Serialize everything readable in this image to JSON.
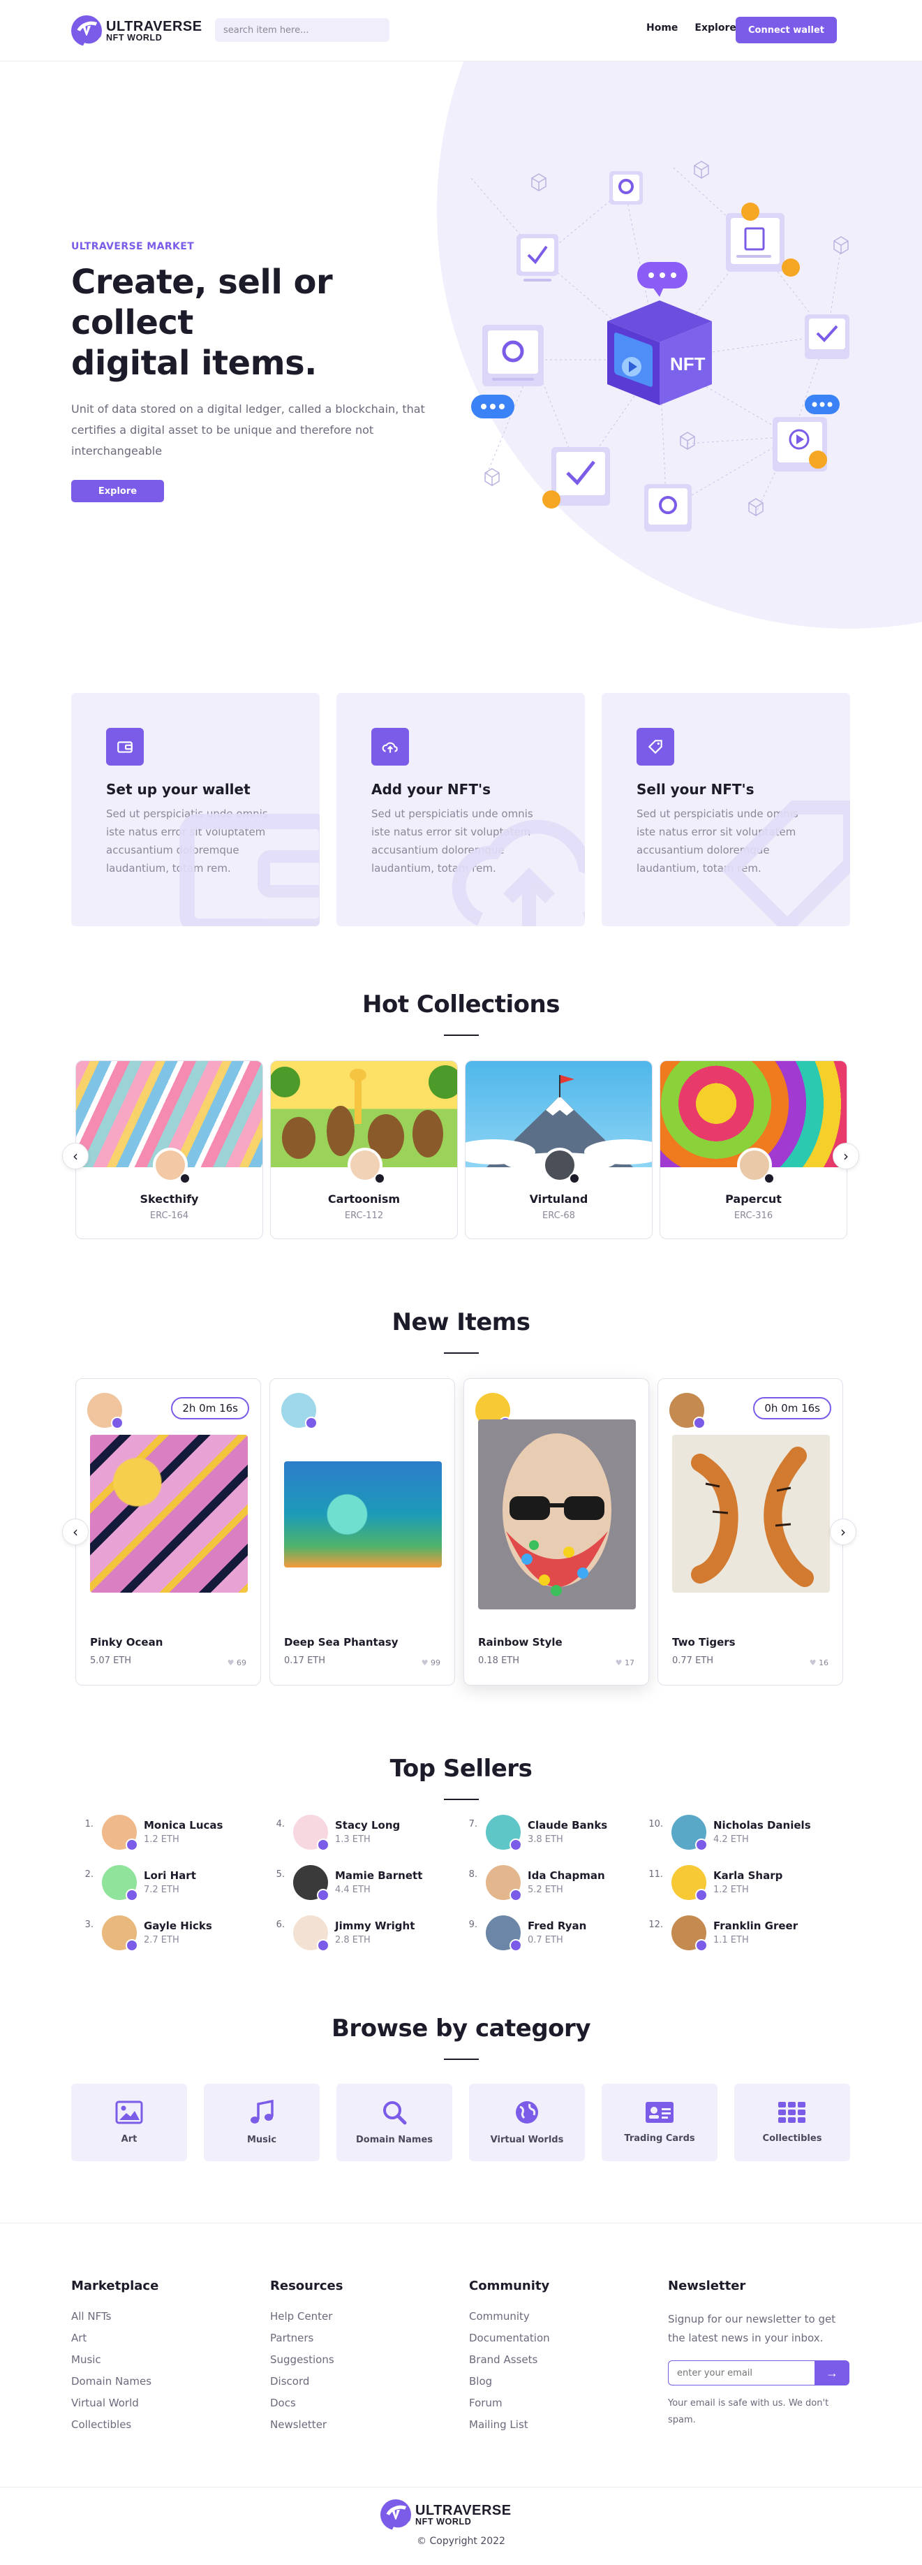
{
  "brand": {
    "name": "ULTRAVERSE",
    "tagline": "NFT WORLD"
  },
  "header": {
    "search_placeholder": "search item here...",
    "nav": [
      "Home",
      "Explore"
    ],
    "connect_label": "Connect wallet"
  },
  "hero": {
    "eyebrow": "ULTRAVERSE MARKET",
    "title_line1": "Create, sell or collect",
    "title_line2": "digital items.",
    "description": "Unit of data stored on a digital ledger, called a blockchain, that certifies a digital asset to be unique and therefore not interchangeable",
    "cta_label": "Explore",
    "illustration_label": "NFT"
  },
  "features": [
    {
      "icon": "wallet-icon",
      "title": "Set up your wallet",
      "desc": "Sed ut perspiciatis unde omnis iste natus error sit voluptatem accusantium doloremque laudantium, totam rem."
    },
    {
      "icon": "cloud-upload-icon",
      "title": "Add your NFT's",
      "desc": "Sed ut perspiciatis unde omnis iste natus error sit voluptatem accusantium doloremque laudantium, totam rem."
    },
    {
      "icon": "tag-icon",
      "title": "Sell your NFT's",
      "desc": "Sed ut perspiciatis unde omnis iste natus error sit voluptatem accusantium doloremque laudantium, totam rem."
    }
  ],
  "hot_collections": {
    "title": "Hot Collections",
    "items": [
      {
        "name": "Skecthify",
        "code": "ERC-164"
      },
      {
        "name": "Cartoonism",
        "code": "ERC-112"
      },
      {
        "name": "Virtuland",
        "code": "ERC-68"
      },
      {
        "name": "Papercut",
        "code": "ERC-316"
      }
    ]
  },
  "new_items": {
    "title": "New Items",
    "items": [
      {
        "name": "Pinky Ocean",
        "price": "5.07 ETH",
        "likes": "69",
        "timer": "2h 0m 16s"
      },
      {
        "name": "Deep Sea Phantasy",
        "price": "0.17 ETH",
        "likes": "99",
        "timer": ""
      },
      {
        "name": "Rainbow Style",
        "price": "0.18 ETH",
        "likes": "17",
        "timer": ""
      },
      {
        "name": "Two Tigers",
        "price": "0.77 ETH",
        "likes": "16",
        "timer": "0h 0m 16s"
      }
    ]
  },
  "top_sellers": {
    "title": "Top Sellers",
    "items": [
      {
        "rank": "1.",
        "name": "Monica Lucas",
        "eth": "1.2 ETH"
      },
      {
        "rank": "2.",
        "name": "Lori Hart",
        "eth": "7.2 ETH"
      },
      {
        "rank": "3.",
        "name": "Gayle Hicks",
        "eth": "2.7 ETH"
      },
      {
        "rank": "4.",
        "name": "Stacy Long",
        "eth": "1.3 ETH"
      },
      {
        "rank": "5.",
        "name": "Mamie Barnett",
        "eth": "4.4 ETH"
      },
      {
        "rank": "6.",
        "name": "Jimmy Wright",
        "eth": "2.8 ETH"
      },
      {
        "rank": "7.",
        "name": "Claude Banks",
        "eth": "3.8 ETH"
      },
      {
        "rank": "8.",
        "name": "Ida Chapman",
        "eth": "5.2 ETH"
      },
      {
        "rank": "9.",
        "name": "Fred Ryan",
        "eth": "0.7 ETH"
      },
      {
        "rank": "10.",
        "name": "Nicholas Daniels",
        "eth": "4.2 ETH"
      },
      {
        "rank": "11.",
        "name": "Karla Sharp",
        "eth": "1.2 ETH"
      },
      {
        "rank": "12.",
        "name": "Franklin Greer",
        "eth": "1.1 ETH"
      }
    ]
  },
  "categories": {
    "title": "Browse by category",
    "items": [
      {
        "label": "Art",
        "icon": "image-icon"
      },
      {
        "label": "Music",
        "icon": "music-icon"
      },
      {
        "label": "Domain Names",
        "icon": "search-icon"
      },
      {
        "label": "Virtual Worlds",
        "icon": "globe-icon"
      },
      {
        "label": "Trading Cards",
        "icon": "id-card-icon"
      },
      {
        "label": "Collectibles",
        "icon": "grid-icon"
      }
    ]
  },
  "footer": {
    "marketplace": {
      "title": "Marketplace",
      "links": [
        "All NFTs",
        "Art",
        "Music",
        "Domain Names",
        "Virtual World",
        "Collectibles"
      ]
    },
    "resources": {
      "title": "Resources",
      "links": [
        "Help Center",
        "Partners",
        "Suggestions",
        "Discord",
        "Docs",
        "Newsletter"
      ]
    },
    "community": {
      "title": "Community",
      "links": [
        "Community",
        "Documentation",
        "Brand Assets",
        "Blog",
        "Forum",
        "Mailing List"
      ]
    },
    "newsletter": {
      "title": "Newsletter",
      "text": "Signup for our newsletter to get the latest news in your inbox.",
      "placeholder": "enter your email",
      "note": "Your email is safe with us. We don't spam."
    },
    "copyright": "© Copyright 2022"
  },
  "colors": {
    "accent": "#7b5ce8",
    "soft": "#f1effc",
    "text": "#1c1b29",
    "muted": "#8a8899"
  }
}
